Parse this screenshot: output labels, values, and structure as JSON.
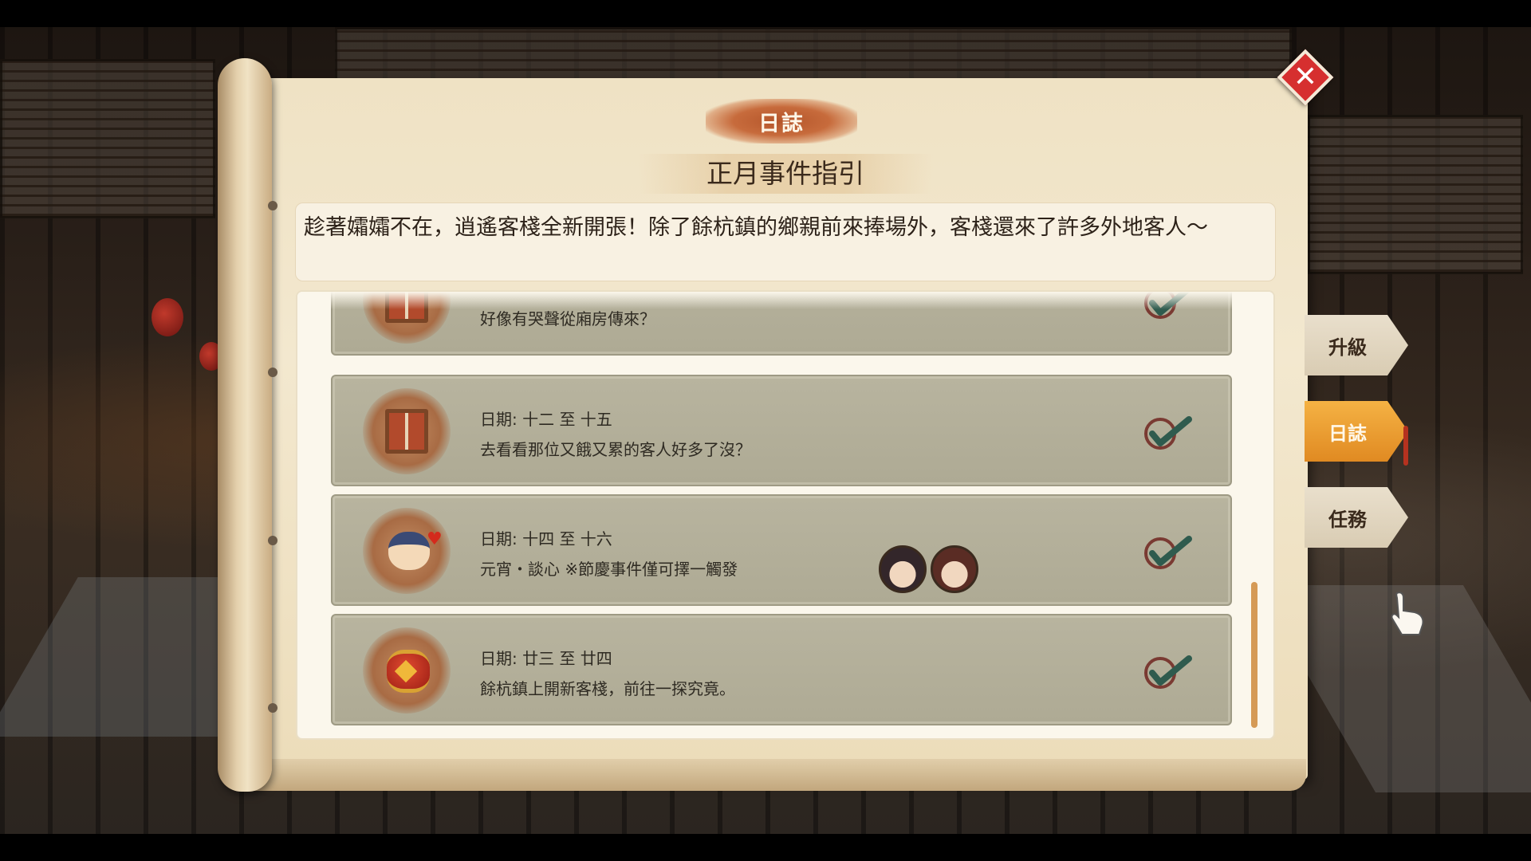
{
  "journal": {
    "title": "日誌",
    "subtitle": "正月事件指引",
    "intro": "趁著孀孀不在，逍遙客棧全新開張！除了餘杭鎮的鄉親前來捧場外，客棧還來了許多外地客人～"
  },
  "events": [
    {
      "date": "",
      "desc": "好像有哭聲從廂房傳來？",
      "icon": "curtain-icon",
      "completed": true
    },
    {
      "date": "日期: 十二 至 十五",
      "desc": "去看看那位又餓又累的客人好多了沒？",
      "icon": "curtain-icon",
      "completed": true
    },
    {
      "date": "日期: 十四 至 十六",
      "desc": "元宵・談心 ※節慶事件僅可擇一觸發",
      "icon": "character-heart-icon",
      "completed": true
    },
    {
      "date": "日期: 廿三 至 廿四",
      "desc": "餘杭鎮上開新客棧，前往一探究竟。",
      "icon": "lantern-icon",
      "completed": true
    }
  ],
  "side_tabs": [
    {
      "label": "升級",
      "active": false
    },
    {
      "label": "日誌",
      "active": true
    },
    {
      "label": "任務",
      "active": false
    }
  ],
  "colors": {
    "accent": "#e08a22",
    "close": "#d62f2f",
    "check": "#2f5b4e"
  }
}
